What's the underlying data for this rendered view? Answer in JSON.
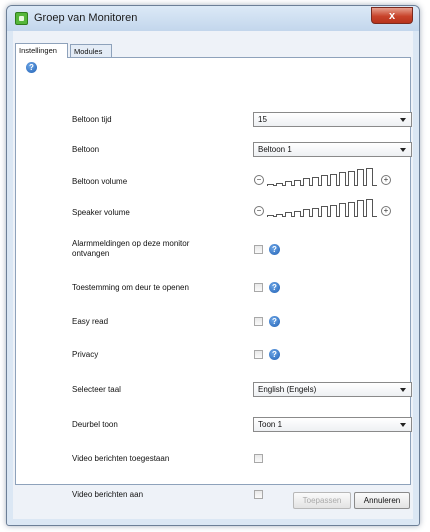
{
  "window": {
    "title": "Groep van Monitoren",
    "close_label": "x"
  },
  "tabs": [
    {
      "label": "Instellingen",
      "active": true
    },
    {
      "label": "Modules",
      "active": false
    }
  ],
  "settings": {
    "beltoon_tijd": {
      "label": "Beltoon tijd",
      "value": "15"
    },
    "beltoon": {
      "label": "Beltoon",
      "value": "Beltoon 1"
    },
    "beltoon_volume": {
      "label": "Beltoon volume",
      "level_fraction": 1.0
    },
    "speaker_volume": {
      "label": "Speaker volume",
      "level_fraction": 1.0
    },
    "alarmmeldingen": {
      "label": "Alarmmeldingen op deze monitor ontvangen",
      "checked": false
    },
    "toestemming": {
      "label": "Toestemming om deur te openen",
      "checked": false
    },
    "easy_read": {
      "label": "Easy read",
      "checked": false
    },
    "privacy": {
      "label": "Privacy",
      "checked": false
    },
    "taal": {
      "label": "Selecteer taal",
      "value": "English (Engels)"
    },
    "deurbel_toon": {
      "label": "Deurbel toon",
      "value": "Toon 1"
    },
    "video_toegestaan": {
      "label": "Video berichten toegestaan",
      "checked": false
    },
    "video_aan": {
      "label": "Video berichten aan",
      "checked": false
    }
  },
  "buttons": {
    "apply": "Toepassen",
    "cancel": "Annuleren"
  },
  "icons": {
    "help": "help-icon",
    "minus": "minus-icon",
    "plus": "plus-icon"
  },
  "colors": {
    "help_blue": "#1f5fb3",
    "app_green": "#55b63a",
    "close_red": "#c8432b"
  }
}
